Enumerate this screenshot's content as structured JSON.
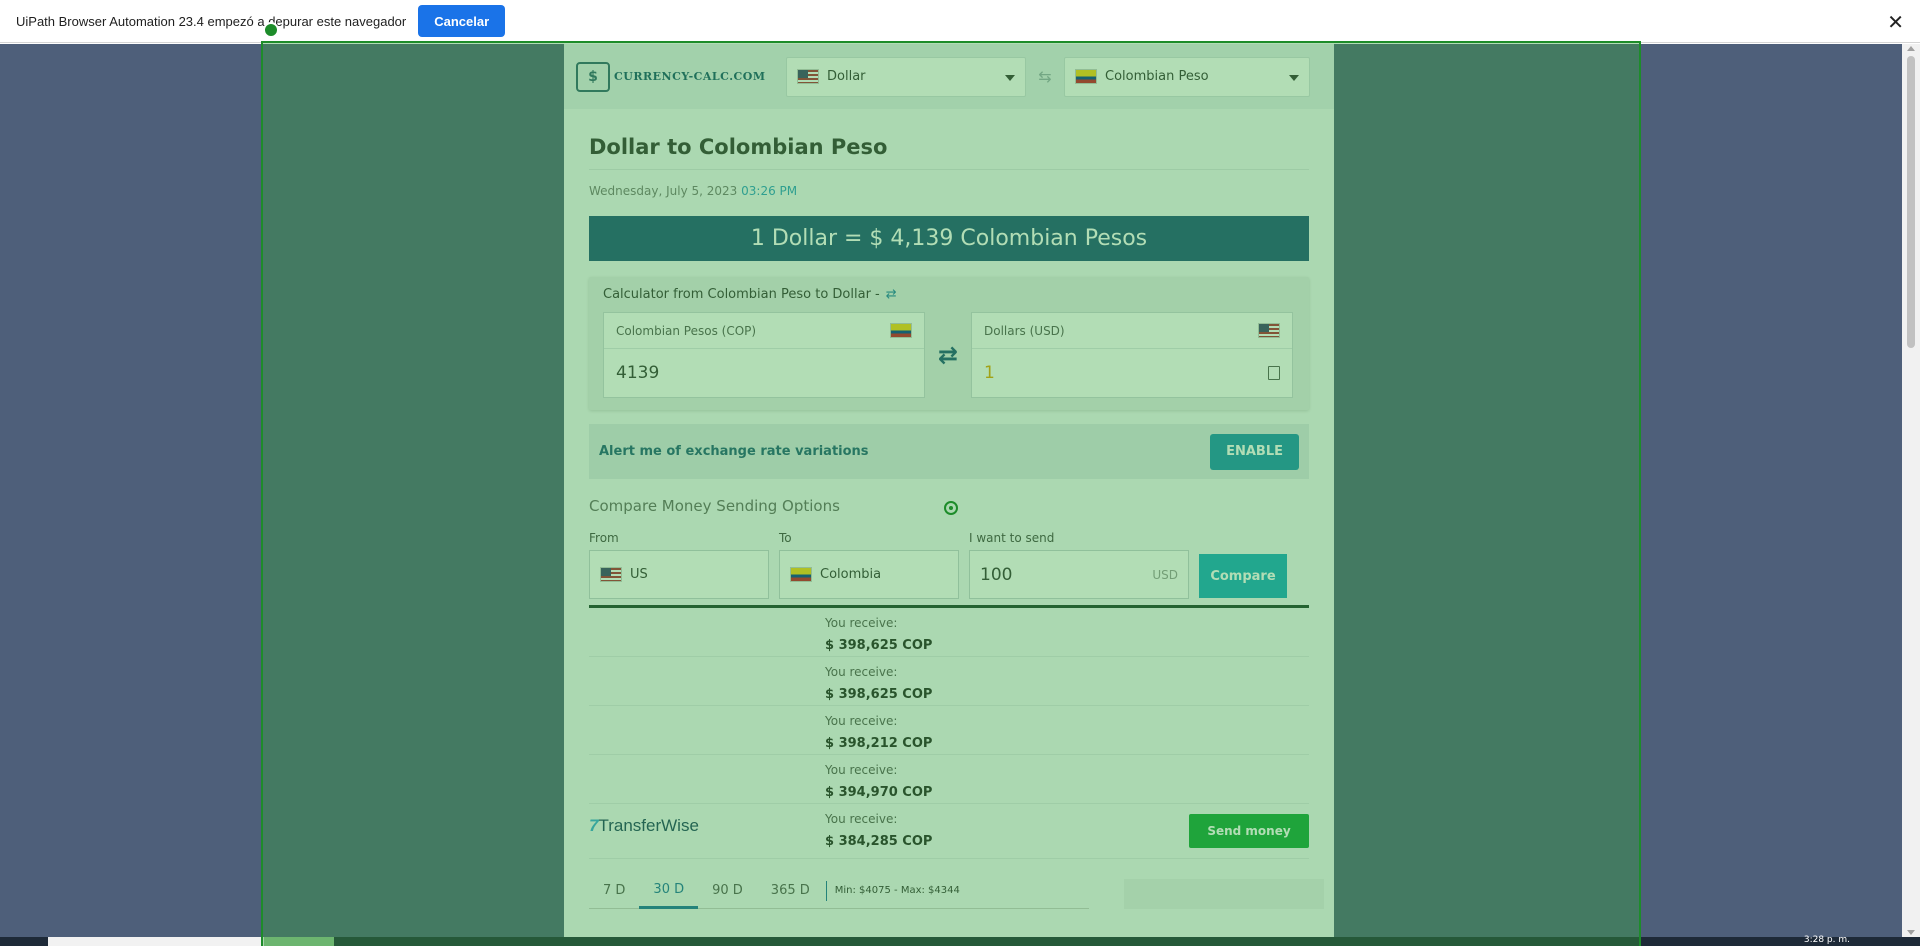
{
  "banner": {
    "message": "UiPath Browser Automation 23.4 empezó a depurar este navegador",
    "cancel_label": "Cancelar",
    "close_glyph": "✕"
  },
  "site": {
    "logo_text": "CURRENCY-CALC.COM",
    "from_currency": "Dollar",
    "to_currency": "Colombian Peso",
    "title": "Dollar to Colombian Peso",
    "date": "Wednesday, July 5, 2023",
    "time": "03:26 PM",
    "rate_banner": "1 Dollar = $ 4,139 Colombian Pesos"
  },
  "calculator": {
    "title": "Calculator from Colombian Peso to Dollar -",
    "from_label": "Colombian Pesos (COP)",
    "from_value": "4139",
    "to_label": "Dollars (USD)",
    "to_value": "1"
  },
  "alert": {
    "text": "Alert me of exchange rate variations",
    "button": "ENABLE"
  },
  "compare": {
    "title": "Compare Money Sending Options",
    "from_label": "From",
    "from_value": "US",
    "to_label": "To",
    "to_value": "Colombia",
    "send_label": "I want to send",
    "send_value": "100",
    "send_unit": "USD",
    "button": "Compare"
  },
  "offers": [
    {
      "receive_label": "You receive:",
      "amount": "$ 398,625 COP",
      "provider": "",
      "button": ""
    },
    {
      "receive_label": "You receive:",
      "amount": "$ 398,625 COP",
      "provider": "",
      "button": ""
    },
    {
      "receive_label": "You receive:",
      "amount": "$ 398,212 COP",
      "provider": "",
      "button": ""
    },
    {
      "receive_label": "You receive:",
      "amount": "$ 394,970 COP",
      "provider": "",
      "button": ""
    },
    {
      "receive_label": "You receive:",
      "amount": "$ 384,285 COP",
      "provider": "TransferWise",
      "button": "Send money"
    }
  ],
  "periods": {
    "items": [
      "7 D",
      "30 D",
      "90 D",
      "365 D"
    ],
    "active": "30 D",
    "minmax": "Min: $4075 - Max: $4344"
  },
  "taskbar": {
    "clock": "3:28 p. m."
  },
  "colors": {
    "highlight": "#1d8c2a",
    "rate_banner": "#1c4f7a",
    "enable_button": "#1b8fb0",
    "compare_button": "#18a9c0",
    "send_button": "#13a33b"
  }
}
